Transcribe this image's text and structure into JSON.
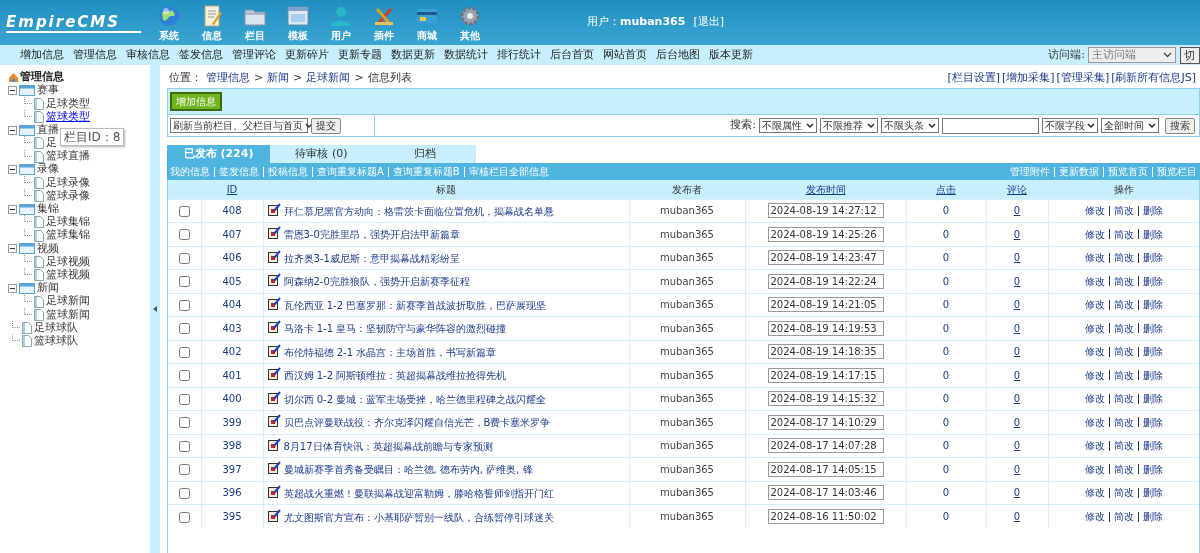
{
  "header": {
    "logo": "EmpireCMS",
    "nav": [
      {
        "label": "系统"
      },
      {
        "label": "信息"
      },
      {
        "label": "栏目"
      },
      {
        "label": "模板"
      },
      {
        "label": "用户"
      },
      {
        "label": "插件"
      },
      {
        "label": "商城"
      },
      {
        "label": "其他"
      }
    ],
    "user_label": "用户：",
    "user_name": "muban365",
    "logout": "[退出]"
  },
  "menu": {
    "items": [
      "增加信息",
      "管理信息",
      "审核信息",
      "签发信息",
      "管理评论",
      "更新碎片",
      "更新专题",
      "数据更新",
      "数据统计",
      "排行统计",
      "后台首页",
      "网站首页",
      "后台地图",
      "版本更新"
    ],
    "visitor_label": "访问端:",
    "visitor_select": "主访问端",
    "switch_button": "切"
  },
  "sidebar": {
    "title": "管理信息",
    "tree": [
      {
        "label": "赛事",
        "selected": false,
        "children": [
          {
            "label": "足球类型",
            "selected": false
          },
          {
            "label": "篮球类型",
            "selected": true
          }
        ]
      },
      {
        "label": "直播",
        "selected": false,
        "children": [
          {
            "label": "足",
            "selected": false
          },
          {
            "label": "篮球直播",
            "selected": false
          }
        ]
      },
      {
        "label": "录像",
        "selected": false,
        "children": [
          {
            "label": "足球录像",
            "selected": false
          },
          {
            "label": "篮球录像",
            "selected": false
          }
        ]
      },
      {
        "label": "集锦",
        "selected": false,
        "children": [
          {
            "label": "足球集锦",
            "selected": false
          },
          {
            "label": "篮球集锦",
            "selected": false
          }
        ]
      },
      {
        "label": "视频",
        "selected": false,
        "children": [
          {
            "label": "足球视频",
            "selected": false
          },
          {
            "label": "篮球视频",
            "selected": false
          }
        ]
      },
      {
        "label": "新闻",
        "selected": false,
        "children": [
          {
            "label": "足球新闻",
            "selected": false
          },
          {
            "label": "篮球新闻",
            "selected": false
          }
        ]
      },
      {
        "label": "足球球队",
        "selected": false
      },
      {
        "label": "篮球球队",
        "selected": false
      }
    ],
    "tooltip": "栏目ID：8"
  },
  "breadcrumb": {
    "label": "位置：",
    "links": [
      "管理信息",
      "新闻",
      "足球新闻"
    ],
    "current": "信息列表",
    "separator": ">"
  },
  "top_links": [
    "[栏目设置]",
    "[增加采集]",
    "[管理采集]",
    "[刷新所有信息JS]"
  ],
  "add_button": "增加信息",
  "refresh_select": "刷新当前栏目、父栏目与首页",
  "submit_button": "提交",
  "search": {
    "label": "搜索:",
    "selects": [
      "不限属性",
      "不限推荐",
      "不限头条"
    ],
    "field_select": "不限字段",
    "time_select": "全部时间",
    "button": "搜索"
  },
  "tabs": [
    {
      "label": "已发布 (224)",
      "selected": true
    },
    {
      "label": "待审核 (0)",
      "selected": false
    },
    {
      "label": "归档",
      "selected": false
    }
  ],
  "filter_links": [
    "我的信息",
    "签发信息",
    "投稿信息",
    "查询重复标题A",
    "查询重复标题B",
    "审核栏目全部信息"
  ],
  "right_links": [
    "管理附件",
    "更新数据",
    "预览首页",
    "预览栏目"
  ],
  "table": {
    "columns": [
      "ID",
      "标题",
      "发布者",
      "发布时间",
      "点击",
      "评论",
      "操作"
    ],
    "rows": [
      {
        "checked": false,
        "id": "408",
        "title": "拜仁慕尼黑官方动向：格雷茨卡面临位置危机，揭幕战名单悬",
        "author": "muban365",
        "time": "2024-08-19 14:27:12",
        "clicks": "0",
        "comments": "0",
        "actions": [
          "修改",
          "简改",
          "删除"
        ]
      },
      {
        "checked": false,
        "id": "407",
        "title": "雷恩3-0完胜里昂，强势开启法甲新篇章",
        "author": "muban365",
        "time": "2024-08-19 14:25:26",
        "clicks": "0",
        "comments": "0",
        "actions": [
          "修改",
          "简改",
          "删除"
        ]
      },
      {
        "checked": false,
        "id": "406",
        "title": "拉齐奥3-1威尼斯：意甲揭幕战精彩纷呈",
        "author": "muban365",
        "time": "2024-08-19 14:23:47",
        "clicks": "0",
        "comments": "0",
        "actions": [
          "修改",
          "简改",
          "删除"
        ]
      },
      {
        "checked": false,
        "id": "405",
        "title": "阿森纳2-0完胜狼队，强势开启新赛季征程",
        "author": "muban365",
        "time": "2024-08-19 14:22:24",
        "clicks": "0",
        "comments": "0",
        "actions": [
          "修改",
          "简改",
          "删除"
        ]
      },
      {
        "checked": false,
        "id": "404",
        "title": "瓦伦西亚 1-2 巴塞罗那：新赛季首战波折取胜，巴萨展现坚",
        "author": "muban365",
        "time": "2024-08-19 14:21:05",
        "clicks": "0",
        "comments": "0",
        "actions": [
          "修改",
          "简改",
          "删除"
        ]
      },
      {
        "checked": false,
        "id": "403",
        "title": "马洛卡 1-1 皇马：坚韧防守与豪华阵容的激烈碰撞",
        "author": "muban365",
        "time": "2024-08-19 14:19:53",
        "clicks": "0",
        "comments": "0",
        "actions": [
          "修改",
          "简改",
          "删除"
        ]
      },
      {
        "checked": false,
        "id": "402",
        "title": "布伦特福德 2-1 水晶宫：主场首胜，书写新篇章",
        "author": "muban365",
        "time": "2024-08-19 14:18:35",
        "clicks": "0",
        "comments": "0",
        "actions": [
          "修改",
          "简改",
          "删除"
        ]
      },
      {
        "checked": false,
        "id": "401",
        "title": "西汉姆 1-2 阿斯顿维拉：英超揭幕战维拉抢得先机",
        "author": "muban365",
        "time": "2024-08-19 14:17:15",
        "clicks": "0",
        "comments": "0",
        "actions": [
          "修改",
          "简改",
          "删除"
        ]
      },
      {
        "checked": false,
        "id": "400",
        "title": "切尔西 0-2 曼城：蓝军主场受挫，哈兰德里程碑之战闪耀全",
        "author": "muban365",
        "time": "2024-08-19 14:15:32",
        "clicks": "0",
        "comments": "0",
        "actions": [
          "修改",
          "简改",
          "删除"
        ]
      },
      {
        "checked": false,
        "id": "399",
        "title": "贝巴点评曼联战役：齐尔克泽闪耀自信光芒，B费卡塞米罗争",
        "author": "muban365",
        "time": "2024-08-17 14:10:29",
        "clicks": "0",
        "comments": "0",
        "actions": [
          "修改",
          "简改",
          "删除"
        ]
      },
      {
        "checked": false,
        "id": "398",
        "title": "8月17日体育快讯：英超揭幕战前瞻与专家预测",
        "author": "muban365",
        "time": "2024-08-17 14:07:28",
        "clicks": "0",
        "comments": "0",
        "actions": [
          "修改",
          "简改",
          "删除"
        ]
      },
      {
        "checked": false,
        "id": "397",
        "title": "曼城新赛季首秀备受瞩目：哈兰德, 德布劳内, 萨维奥, 锋",
        "author": "muban365",
        "time": "2024-08-17 14:05:15",
        "clicks": "0",
        "comments": "0",
        "actions": [
          "修改",
          "简改",
          "删除"
        ]
      },
      {
        "checked": false,
        "id": "396",
        "title": "英超战火重燃！曼联揭幕战迎富勒姆，滕哈格誓师剑指开门红",
        "author": "muban365",
        "time": "2024-08-17 14:03:46",
        "clicks": "0",
        "comments": "0",
        "actions": [
          "修改",
          "简改",
          "删除"
        ]
      },
      {
        "checked": false,
        "id": "395",
        "title": "尤文图斯官方宣布：小基耶萨暂别一线队，合练暂停引球迷关",
        "author": "muban365",
        "time": "2024-08-16 11:50:02",
        "clicks": "0",
        "comments": "0",
        "actions": [
          "修改",
          "简改",
          "删除"
        ]
      }
    ]
  }
}
